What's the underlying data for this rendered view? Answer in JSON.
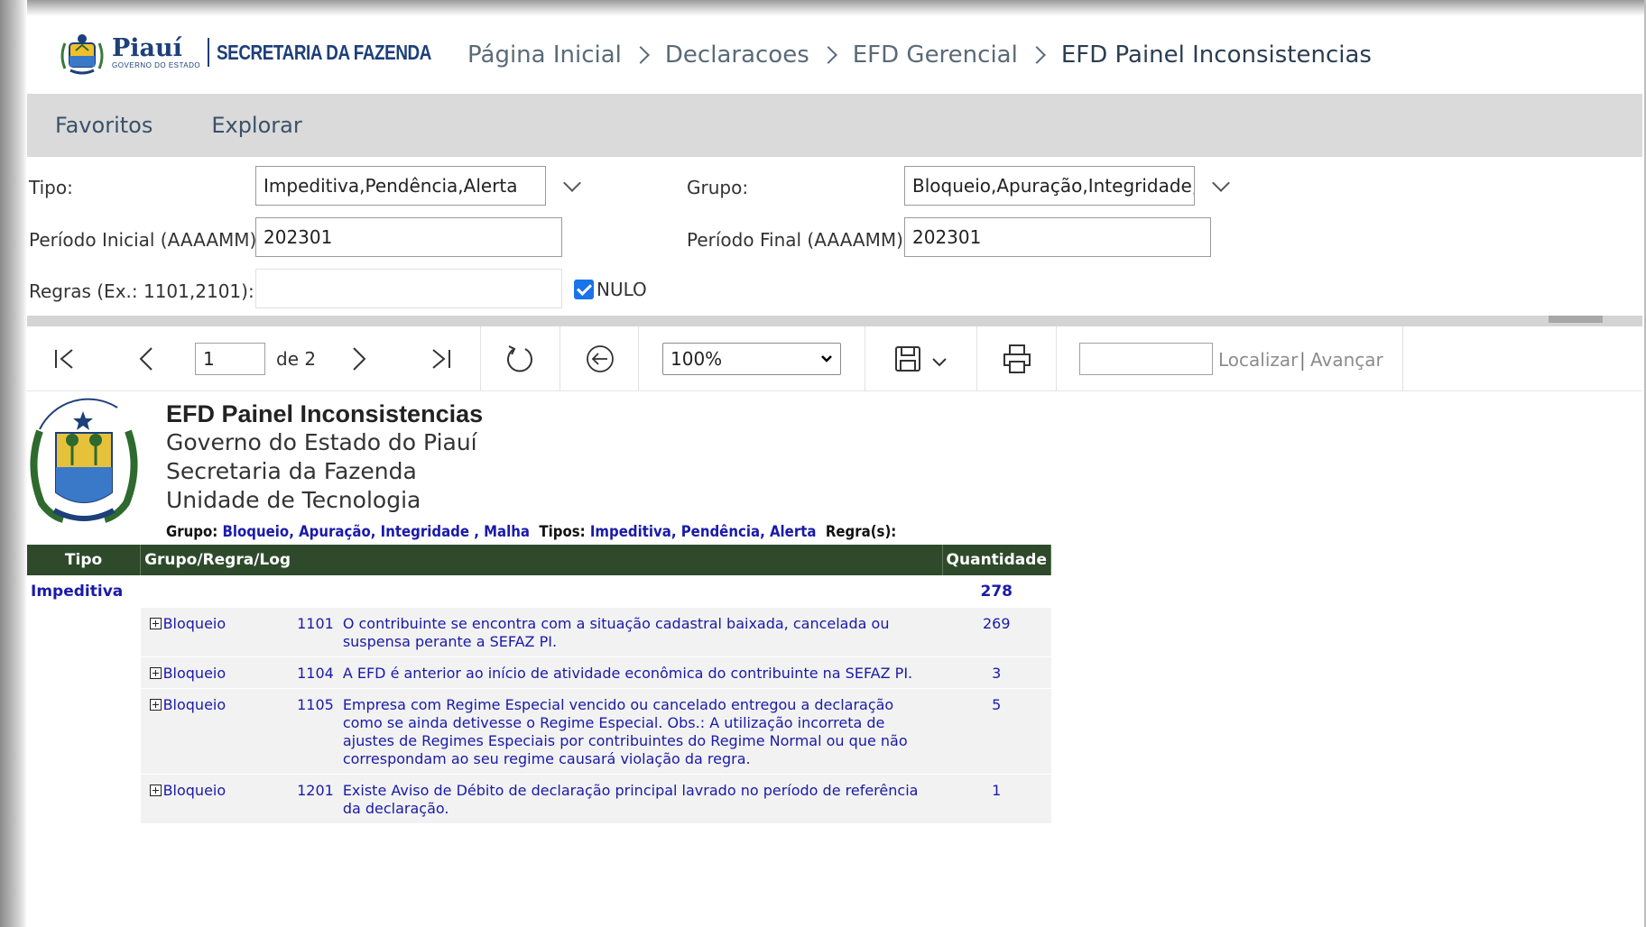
{
  "header": {
    "logo_name": "Piauí",
    "logo_sub": "GOVERNO DO ESTADO",
    "secretaria": "SECRETARIA DA FAZENDA",
    "breadcrumb": [
      "Página Inicial",
      "Declaracoes",
      "EFD Gerencial",
      "EFD Painel Inconsistencias"
    ]
  },
  "nav": {
    "items": [
      "Favoritos",
      "Explorar"
    ]
  },
  "params": {
    "tipo_label": "Tipo:",
    "tipo_value": "Impeditiva,Pendência,Alerta",
    "grupo_label": "Grupo:",
    "grupo_value": "Bloqueio,Apuração,Integridade,Ma",
    "periodo_inicial_label": "Período Inicial (AAAAMM):",
    "periodo_inicial_value": "202301",
    "periodo_final_label": "Período Final (AAAAMM):",
    "periodo_final_value": "202301",
    "regras_label": "Regras (Ex.: 1101,2101):",
    "regras_value": "",
    "nulo_label": "NULO",
    "nulo_checked": true
  },
  "toolbar": {
    "page_current": "1",
    "page_of": "de 2",
    "zoom": "100%",
    "find_value": "",
    "find_label": "Localizar",
    "next_label": "Avançar",
    "icons": [
      "first-page-icon",
      "prev-page-icon",
      "next-page-icon",
      "last-page-icon",
      "refresh-icon",
      "back-icon",
      "save-icon",
      "print-icon"
    ]
  },
  "report": {
    "title": "EFD Painel Inconsistencias",
    "lines": [
      "Governo do Estado do Piauí",
      "Secretaria da Fazenda",
      "Unidade de Tecnologia"
    ],
    "filter_grupo_label": "Grupo:",
    "filter_grupo_value": "Bloqueio, Apuração, Integridade , Malha",
    "filter_tipos_label": "Tipos:",
    "filter_tipos_value": "Impeditiva, Pendência, Alerta",
    "filter_regras_label": "Regra(s):",
    "columns": [
      "Tipo",
      "Grupo/Regra/Log",
      "Quantidade"
    ],
    "group": {
      "tipo": "Impeditiva",
      "total": "278"
    },
    "rows": [
      {
        "grupo": "Bloqueio",
        "regra": "1101",
        "descricao": "O contribuinte se encontra com a situação cadastral baixada, cancelada ou suspensa perante a SEFAZ PI.",
        "quantidade": "269"
      },
      {
        "grupo": "Bloqueio",
        "regra": "1104",
        "descricao": "A EFD é anterior ao início de atividade econômica do contribuinte na SEFAZ PI.",
        "quantidade": "3"
      },
      {
        "grupo": "Bloqueio",
        "regra": "1105",
        "descricao": "Empresa com Regime Especial vencido ou cancelado entregou a declaração como se ainda detivesse o Regime Especial. Obs.: A utilização incorreta de ajustes de Regimes Especiais por contribuintes do Regime Normal ou que não correspondam ao seu regime causará violação da regra.",
        "quantidade": "5"
      },
      {
        "grupo": "Bloqueio",
        "regra": "1201",
        "descricao": "Existe Aviso de Débito de declaração principal lavrado no período de referência da declaração.",
        "quantidade": "1"
      }
    ]
  }
}
